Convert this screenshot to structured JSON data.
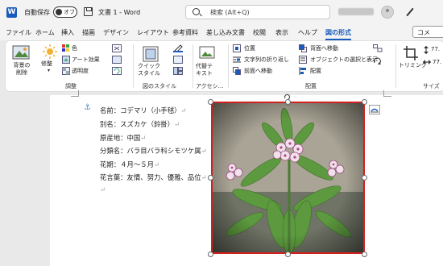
{
  "titlebar": {
    "autosave_label": "自動保存",
    "autosave_state": "オフ",
    "doc_title": "文書 1  -  Word",
    "search_placeholder": "検索 (Alt+Q)"
  },
  "tabs": [
    {
      "label": "ファイル"
    },
    {
      "label": "ホーム"
    },
    {
      "label": "挿入"
    },
    {
      "label": "描画"
    },
    {
      "label": "デザイン"
    },
    {
      "label": "レイアウト"
    },
    {
      "label": "参考資料"
    },
    {
      "label": "差し込み文書"
    },
    {
      "label": "校閲"
    },
    {
      "label": "表示"
    },
    {
      "label": "ヘルプ"
    },
    {
      "label": "図の形式",
      "active": true
    }
  ],
  "comment_button": "コメ",
  "ribbon": {
    "remove_bg": "背景の\n削除",
    "corrections": "修整",
    "color": "色",
    "artistic": "アート効果",
    "transparency": "透明度",
    "group_adjust": "調整",
    "quick_styles": "クイック\nスタイル",
    "group_styles": "図のスタイル",
    "alt_text": "代替テ\nキスト",
    "group_access": "アクセシ...",
    "position": "位置",
    "wrap_text": "文字列の折り返し",
    "bring_forward": "前面へ移動",
    "send_backward": "背面へ移動",
    "selection_pane": "オブジェクトの選択と表示",
    "align": "配置",
    "group_arrange": "配置",
    "crop": "トリミング",
    "group_size": "サイズ",
    "size_h": "77.",
    "size_w": "77."
  },
  "document": {
    "lines": [
      "名前：コデマリ（小手毬）",
      "別名：スズカケ（鈴掛）",
      "原産地：中国",
      "分類名：バラ目バラ科シモツケ属",
      "花期：４月～５月",
      "花言葉：友情、努力、優雅、品位"
    ],
    "pilcrow": "↵"
  },
  "colors": {
    "accent": "#185abd",
    "selection_border": "#d21f1f"
  }
}
